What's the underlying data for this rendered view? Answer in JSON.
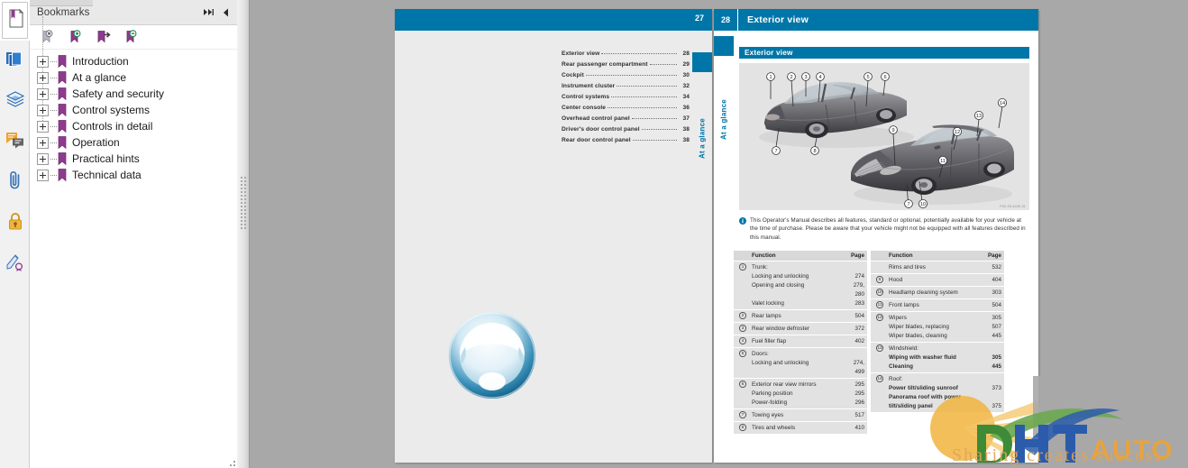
{
  "app": {
    "panel_title": "Bookmarks",
    "panel_expand_icon": "double-right-arrow-icon",
    "panel_collapse_icon": "left-triangle-icon"
  },
  "rail": {
    "items": [
      {
        "icon": "bookmarks-icon",
        "label": "Bookmarks",
        "active": true
      },
      {
        "icon": "pages-thumbnails-icon",
        "label": "Page Thumbnails",
        "active": false
      },
      {
        "icon": "layers-icon",
        "label": "Layers",
        "active": false
      },
      {
        "icon": "comments-icon",
        "label": "Comments",
        "active": false
      },
      {
        "icon": "attachments-paperclip-icon",
        "label": "Attachments",
        "active": false
      },
      {
        "icon": "lock-security-icon",
        "label": "Security",
        "active": false
      },
      {
        "icon": "signature-icon",
        "label": "Signatures",
        "active": false
      }
    ]
  },
  "bookmark_toolbar": {
    "tools": [
      {
        "icon": "delete-bookmark-icon",
        "label": "Delete bookmark"
      },
      {
        "icon": "new-bookmark-icon",
        "label": "New bookmark"
      },
      {
        "icon": "goto-bookmark-icon",
        "label": "Go to bookmark"
      },
      {
        "icon": "bookmark-options-icon",
        "label": "Bookmark options"
      }
    ]
  },
  "bookmarks": {
    "items": [
      {
        "label": "Introduction"
      },
      {
        "label": "At a glance"
      },
      {
        "label": "Safety and security"
      },
      {
        "label": "Control systems"
      },
      {
        "label": "Controls in detail"
      },
      {
        "label": "Operation"
      },
      {
        "label": "Practical hints"
      },
      {
        "label": "Technical data"
      }
    ]
  },
  "left_page": {
    "page_number": "27",
    "tab_label": "At a glance",
    "toc": [
      {
        "name": "Exterior view",
        "page": "28"
      },
      {
        "name": "Rear passenger compartment",
        "page": "29"
      },
      {
        "name": "Cockpit",
        "page": "30"
      },
      {
        "name": "Instrument cluster",
        "page": "32"
      },
      {
        "name": "Control systems",
        "page": "34"
      },
      {
        "name": "Center console",
        "page": "36"
      },
      {
        "name": "Overhead control panel",
        "page": "37"
      },
      {
        "name": "Driver's door control panel",
        "page": "38"
      },
      {
        "name": "Rear door control panel",
        "page": "38"
      }
    ],
    "watermark_logo": "steering-wheel-logo"
  },
  "right_page": {
    "page_number": "28",
    "header_title": "Exterior view",
    "tab_label": "At a glance",
    "section_title": "Exterior view",
    "figure": {
      "alt": "Two Mercedes-Benz S-Class sedans with numbered callouts 1 to 14",
      "caption_code": "P00.00-4449-31",
      "callouts": [
        "1",
        "2",
        "3",
        "4",
        "5",
        "6",
        "7",
        "8",
        "9",
        "10",
        "11",
        "12",
        "13",
        "14"
      ]
    },
    "note": {
      "icon": "info-icon",
      "text": "This Operator's Manual describes all features, standard or optional, potentially available for your vehicle at the time of purchase. Please be aware that your vehicle might not be equipped with all features described in this manual."
    },
    "table_left": {
      "headers": {
        "function": "Function",
        "page": "Page"
      },
      "rows": [
        {
          "num": "1",
          "lines": [
            {
              "label": "Trunk:",
              "page": ""
            },
            {
              "label": "Locking and unlocking",
              "page": "274"
            },
            {
              "label": "Opening and closing",
              "page": "279,"
            },
            {
              "label": "",
              "page": "280"
            },
            {
              "label": "Valet locking",
              "page": "283"
            }
          ]
        },
        {
          "num": "2",
          "lines": [
            {
              "label": "Rear lamps",
              "page": "504"
            }
          ]
        },
        {
          "num": "3",
          "lines": [
            {
              "label": "Rear window defroster",
              "page": "372"
            }
          ]
        },
        {
          "num": "4",
          "lines": [
            {
              "label": "Fuel filler flap",
              "page": "402"
            }
          ]
        },
        {
          "num": "5",
          "lines": [
            {
              "label": "Doors:",
              "page": ""
            },
            {
              "label": "Locking and unlocking",
              "page": "274,"
            },
            {
              "label": "",
              "page": "499"
            }
          ]
        },
        {
          "num": "6",
          "lines": [
            {
              "label": "Exterior rear view mirrors",
              "page": "295"
            },
            {
              "label": "Parking position",
              "page": "295"
            },
            {
              "label": "Power-folding",
              "page": "296"
            }
          ]
        },
        {
          "num": "7",
          "lines": [
            {
              "label": "Towing eyes",
              "page": "517"
            }
          ]
        },
        {
          "num": "8",
          "lines": [
            {
              "label": "Tires and wheels",
              "page": "410"
            }
          ]
        }
      ]
    },
    "table_right": {
      "headers": {
        "function": "Function",
        "page": "Page"
      },
      "rows": [
        {
          "num": "",
          "lines": [
            {
              "label": "Rims and tires",
              "page": "532"
            }
          ]
        },
        {
          "num": "9",
          "lines": [
            {
              "label": "Hood",
              "page": "404"
            }
          ]
        },
        {
          "num": "10",
          "lines": [
            {
              "label": "Headlamp cleaning system",
              "page": "303"
            }
          ]
        },
        {
          "num": "11",
          "lines": [
            {
              "label": "Front lamps",
              "page": "504"
            }
          ]
        },
        {
          "num": "12",
          "lines": [
            {
              "label": "Wipers",
              "page": "305"
            },
            {
              "label": "Wiper blades, replacing",
              "page": "507"
            },
            {
              "label": "Wiper blades, cleaning",
              "page": "445"
            }
          ]
        },
        {
          "num": "13",
          "lines": [
            {
              "label": "Windshield:",
              "page": ""
            },
            {
              "label": "Wiping with washer fluid",
              "page": "305"
            },
            {
              "label": "Cleaning",
              "page": "445"
            }
          ]
        },
        {
          "num": "14",
          "lines": [
            {
              "label": "Roof:",
              "page": ""
            },
            {
              "label": "Power tilt/sliding sunroof",
              "page": "373"
            },
            {
              "label": "Panorama roof with power",
              "page": ""
            },
            {
              "label": "tilt/sliding panel",
              "page": "375"
            }
          ]
        }
      ]
    }
  },
  "watermark": {
    "brand": "DHT",
    "brand_suffix": "AUTO",
    "tagline": "Sharing creates success"
  },
  "colors": {
    "brand_blue": "#0076a8",
    "page_bg": "#ebebeb",
    "table_row": "#e2e2e2",
    "table_head": "#d8d8d8",
    "desk": "#a8a8a8",
    "bookmark_purple": "#8e3b8e",
    "watermark_green": "#5aa04a",
    "watermark_blue": "#2b5cab",
    "watermark_gray": "#a9a9a9",
    "watermark_orange": "#e0a558"
  }
}
